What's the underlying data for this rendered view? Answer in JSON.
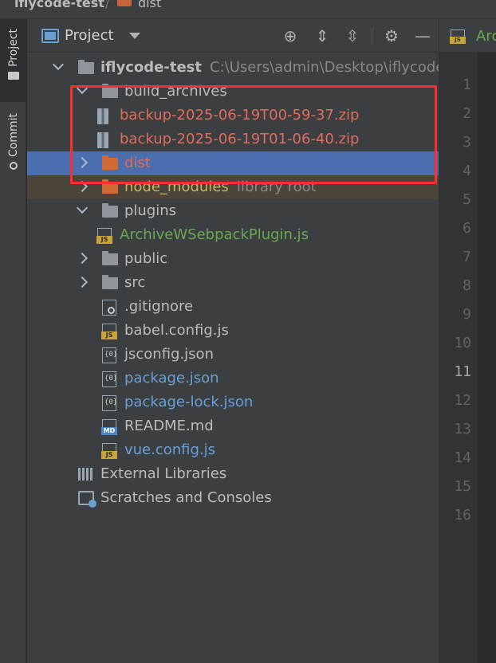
{
  "breadcrumb": {
    "root": "iflycode-test",
    "separator": "/",
    "child": "dist"
  },
  "stripe": {
    "project_tab": "Project",
    "commit_tab": "Commit"
  },
  "toolbar": {
    "title": "Project",
    "icons": [
      "locate-icon",
      "expand-all-icon",
      "collapse-all-icon",
      "gear-icon",
      "minimize-icon"
    ]
  },
  "tree": [
    {
      "label": "iflycode-test",
      "suffix": "C:\\Users\\admin\\Desktop\\iflycode_test",
      "kind": "folder",
      "arrow": "down",
      "indent": 0,
      "color": "default",
      "bold": true
    },
    {
      "label": "build_archives",
      "kind": "folder",
      "arrow": "down",
      "indent": 1,
      "color": "default"
    },
    {
      "label": "backup-2025-06-19T00-59-37.zip",
      "kind": "zip",
      "indent": 2,
      "color": "red"
    },
    {
      "label": "backup-2025-06-19T01-06-40.zip",
      "kind": "zip",
      "indent": 2,
      "color": "red"
    },
    {
      "label": "dist",
      "kind": "folder-orange",
      "arrow": "right",
      "indent": 1,
      "color": "red",
      "state": "selected"
    },
    {
      "label": "node_modules",
      "suffix": "library root",
      "kind": "folder-orange",
      "arrow": "right",
      "indent": 1,
      "color": "yellow",
      "state": "excluded"
    },
    {
      "label": "plugins",
      "kind": "folder",
      "arrow": "down",
      "indent": 1,
      "color": "default"
    },
    {
      "label": "ArchiveWSebpackPlugin.js",
      "kind": "js",
      "indent": 2,
      "color": "green"
    },
    {
      "label": "public",
      "kind": "folder",
      "arrow": "right",
      "indent": 1,
      "color": "default"
    },
    {
      "label": "src",
      "kind": "folder",
      "arrow": "right",
      "indent": 1,
      "color": "default"
    },
    {
      "label": ".gitignore",
      "kind": "git",
      "indent": 1,
      "color": "default"
    },
    {
      "label": "babel.config.js",
      "kind": "js",
      "indent": 1,
      "color": "default"
    },
    {
      "label": "jsconfig.json",
      "kind": "json",
      "indent": 1,
      "color": "default"
    },
    {
      "label": "package.json",
      "kind": "json",
      "indent": 1,
      "color": "blue"
    },
    {
      "label": "package-lock.json",
      "kind": "json",
      "indent": 1,
      "color": "blue"
    },
    {
      "label": "README.md",
      "kind": "md",
      "indent": 1,
      "color": "default"
    },
    {
      "label": "vue.config.js",
      "kind": "js",
      "indent": 1,
      "color": "blue"
    },
    {
      "label": "External Libraries",
      "kind": "lib",
      "indent": 0,
      "color": "default"
    },
    {
      "label": "Scratches and Consoles",
      "kind": "scratch",
      "indent": 0,
      "color": "default"
    }
  ],
  "icon_tags": {
    "js": "JS",
    "md": "MD",
    "json": "{0}"
  },
  "editor": {
    "tab_label": "Arc",
    "line_numbers": [
      "1",
      "2",
      "3",
      "4",
      "5",
      "6",
      "7",
      "8",
      "9",
      "10",
      "11",
      "12",
      "13",
      "14",
      "15",
      "16"
    ],
    "current_line": "11"
  },
  "colors": {
    "highlight": "#ff2d2d",
    "selection": "#4b6eaf",
    "excluded_bg": "#4a4538",
    "modified_blue": "#6a9fd4",
    "untracked_red": "#e06c5a",
    "added_green": "#6aa84f",
    "excluded_yellow": "#c8b45a"
  }
}
